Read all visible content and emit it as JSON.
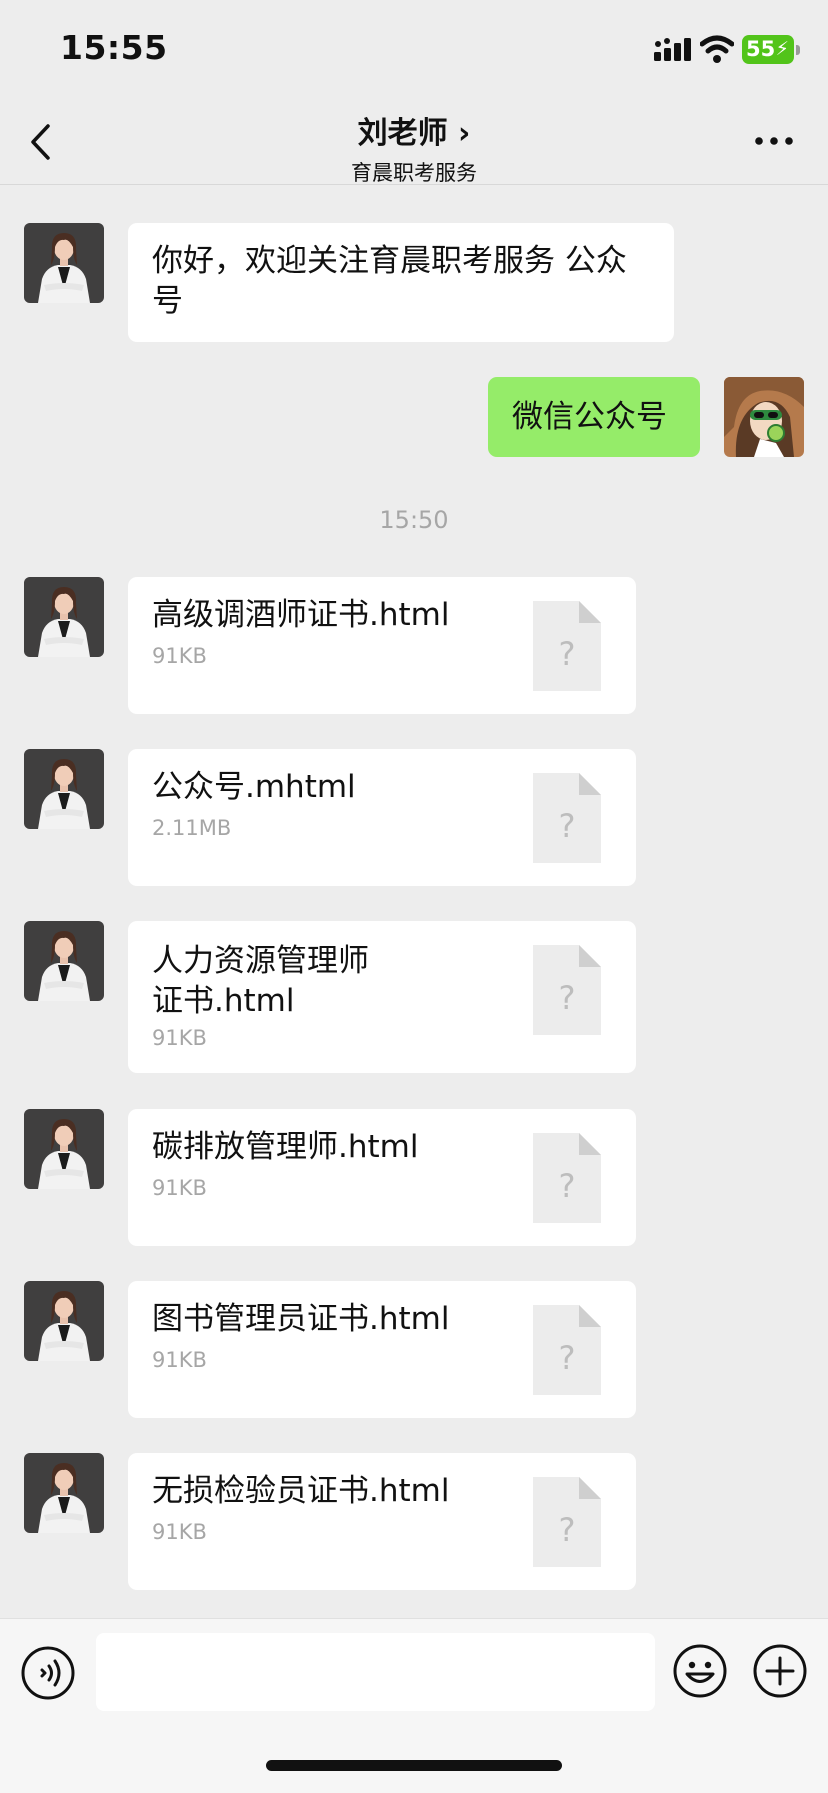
{
  "status_bar": {
    "time": "15:55",
    "battery": "55"
  },
  "header": {
    "title": "刘老师 ›",
    "subtitle": "育晨职考服务"
  },
  "messages": {
    "welcome": "你好，欢迎关注育晨职考服务 公众号",
    "reply": "微信公众号",
    "timestamp": "15:50",
    "files": [
      {
        "name": "高级调酒师证书.html",
        "size": "91KB"
      },
      {
        "name": "公众号.mhtml",
        "size": "2.11MB"
      },
      {
        "name": "人力资源管理师证书.html",
        "size": "91KB"
      },
      {
        "name": "碳排放管理师.html",
        "size": "91KB"
      },
      {
        "name": "图书管理员证书.html",
        "size": "91KB"
      },
      {
        "name": "无损检验员证书.html",
        "size": "91KB"
      }
    ]
  },
  "icons": {
    "back": "chevron-left-icon",
    "more": "ellipsis-icon",
    "voice": "voice-icon",
    "emoji": "smiley-icon",
    "plus": "plus-icon",
    "file": "unknown-file-icon"
  },
  "colors": {
    "background": "#ededed",
    "sent_bubble": "#95ec69",
    "battery": "#52c41a"
  }
}
